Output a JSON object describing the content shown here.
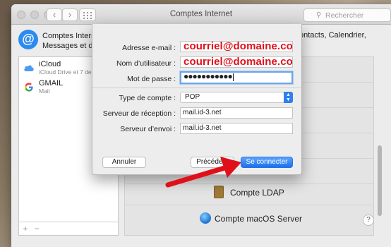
{
  "window": {
    "title": "Comptes Internet",
    "search_placeholder": "Rechercher",
    "header_left": [
      "Comptes Internet",
      "Messages et d’au"
    ],
    "header_right": "ontacts, Calendrier,"
  },
  "sidebar": {
    "accounts": [
      {
        "name": "iCloud",
        "sub": "iCloud Drive et 7 de p"
      },
      {
        "name": "GMAIL",
        "sub": "Mail"
      }
    ],
    "add": "+",
    "remove": "−"
  },
  "providers": {
    "ldap_label": "Compte LDAP",
    "macos_label": "Compte macOS Server"
  },
  "sheet": {
    "email_label": "Adresse e-mail :",
    "email_value": "courriel@domaine.com",
    "username_label": "Nom d’utilisateur :",
    "username_value": "courriel@domaine.com",
    "password_label": "Mot de passe :",
    "password_value": "●●●●●●●●●●●",
    "account_type_label": "Type de compte :",
    "account_type_value": "POP",
    "incoming_label": "Serveur de réception :",
    "incoming_value": "mail.id-3.net",
    "outgoing_label": "Serveur d’envoi :",
    "outgoing_value": "mail.id-3.net",
    "cancel": "Annuler",
    "previous": "Précédent",
    "connect": "Se connecter"
  },
  "help": "?",
  "colors": {
    "accent": "#2f7ff0",
    "annotation_red": "#e0101a"
  }
}
